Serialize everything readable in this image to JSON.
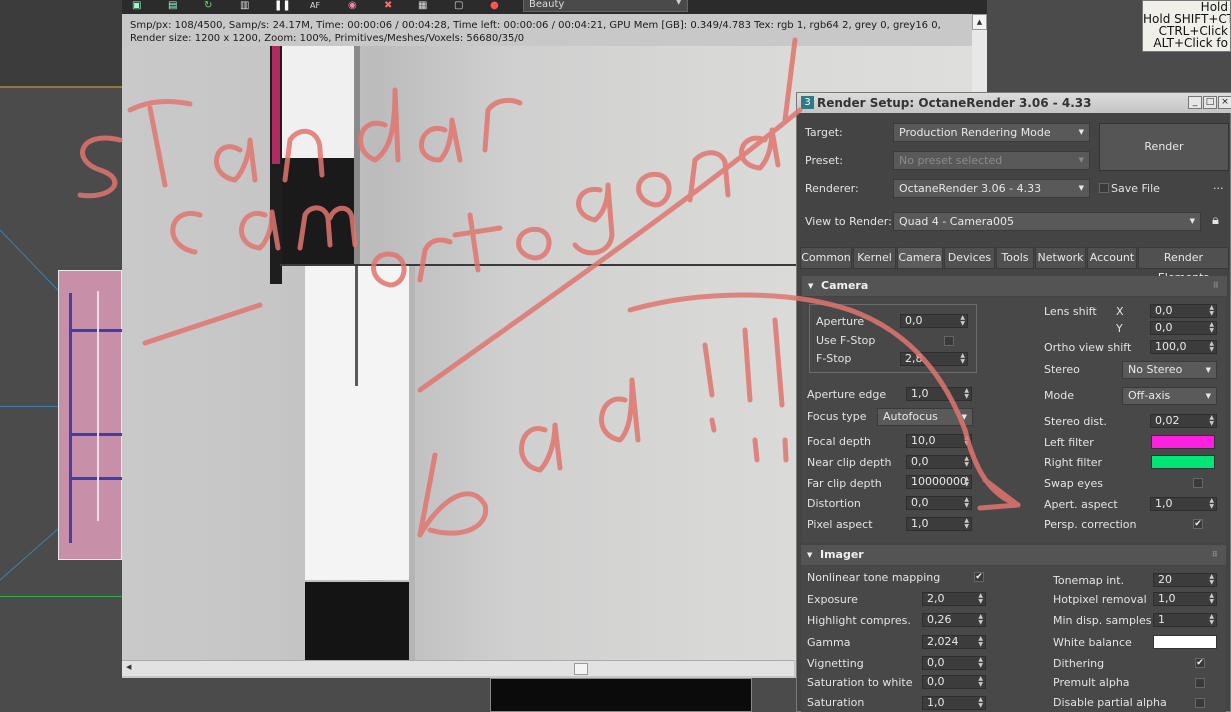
{
  "vfb": {
    "channel_dropdown": "Beauty",
    "stats_line1": "Smp/px: 108/4500,   Samp/s: 24.17M,   Time: 00:00:06 / 00:04:28,   Time left: 00:00:06 / 00:04:21,   GPU Mem [GB]: 0.349/4.783   Tex: rgb 1, rgb64 2, grey 0, grey16 0,",
    "stats_line2": "Render size: 1200 x 1200,   Zoom: 100%,   Primitives/Meshes/Voxels: 56680/35/0"
  },
  "tooltip": {
    "lines": [
      "Hold",
      "Hold SHIFT+CT",
      "CTRL+Click",
      "ALT+Click fo"
    ]
  },
  "render_setup": {
    "title": "Render Setup: OctaneRender 3.06 - 4.33",
    "logo": "3",
    "target_label": "Target:",
    "target_value": "Production Rendering Mode",
    "preset_label": "Preset:",
    "preset_value": "No preset selected",
    "renderer_label": "Renderer:",
    "renderer_value": "OctaneRender 3.06 - 4.33",
    "save_file_label": "Save File",
    "more_label": "...",
    "view_label": "View to Render:",
    "view_value": "Quad 4 - Camera005",
    "render_button": "Render",
    "tabs": [
      "Common",
      "Kernel",
      "Camera",
      "Devices",
      "Tools",
      "Network",
      "Account",
      "Render Elements"
    ],
    "active_tab": "Camera"
  },
  "camera": {
    "section_title": "Camera",
    "aperture_label": "Aperture",
    "aperture": "0,0",
    "use_fstop_label": "Use F-Stop",
    "fstop_label": "F-Stop",
    "fstop": "2,8",
    "aperture_edge_label": "Aperture edge",
    "aperture_edge": "1,0",
    "focus_type_label": "Focus type",
    "focus_type": "Autofocus",
    "focal_depth_label": "Focal depth",
    "focal_depth": "10,0",
    "near_clip_label": "Near clip depth",
    "near_clip": "0,0",
    "far_clip_label": "Far clip depth",
    "far_clip": "10000000",
    "distortion_label": "Distortion",
    "distortion": "0,0",
    "pixel_aspect_label": "Pixel aspect",
    "pixel_aspect": "1,0",
    "lens_shift_label": "Lens shift",
    "x_label": "X",
    "lens_shift_x": "0,0",
    "y_label": "Y",
    "lens_shift_y": "0,0",
    "ortho_shift_label": "Ortho view shift",
    "ortho_shift": "100,0",
    "stereo_label": "Stereo",
    "stereo": "No Stereo",
    "mode_label": "Mode",
    "mode": "Off-axis",
    "stereo_dist_label": "Stereo dist.",
    "stereo_dist": "0,02",
    "left_filter_label": "Left filter",
    "left_filter_color": "#ff1fe0",
    "right_filter_label": "Right filter",
    "right_filter_color": "#00e676",
    "swap_eyes_label": "Swap eyes",
    "apert_aspect_label": "Apert. aspect",
    "apert_aspect": "1,0",
    "persp_correction_label": "Persp. correction",
    "check_mark": "✔"
  },
  "imager": {
    "section_title": "Imager",
    "nonlinear_label": "Nonlinear tone mapping",
    "exposure_label": "Exposure",
    "exposure": "2,0",
    "highlight_label": "Highlight compres.",
    "highlight": "0,26",
    "gamma_label": "Gamma",
    "gamma": "2,024",
    "vignetting_label": "Vignetting",
    "vignetting": "0,0",
    "sat_white_label": "Saturation to white",
    "sat_white": "0,0",
    "saturation_label": "Saturation",
    "saturation": "1,0",
    "tonemap_label": "Tonemap int.",
    "tonemap": "20",
    "hotpixel_label": "Hotpixel removal",
    "hotpixel": "1,0",
    "min_disp_label": "Min disp. samples",
    "min_disp": "1",
    "white_balance_label": "White balance",
    "white_balance_color": "#ffffff",
    "dithering_label": "Dithering",
    "premult_label": "Premult alpha",
    "disable_partial_label": "Disable partial alpha"
  },
  "colors": {
    "scribble": "#e0756e"
  }
}
